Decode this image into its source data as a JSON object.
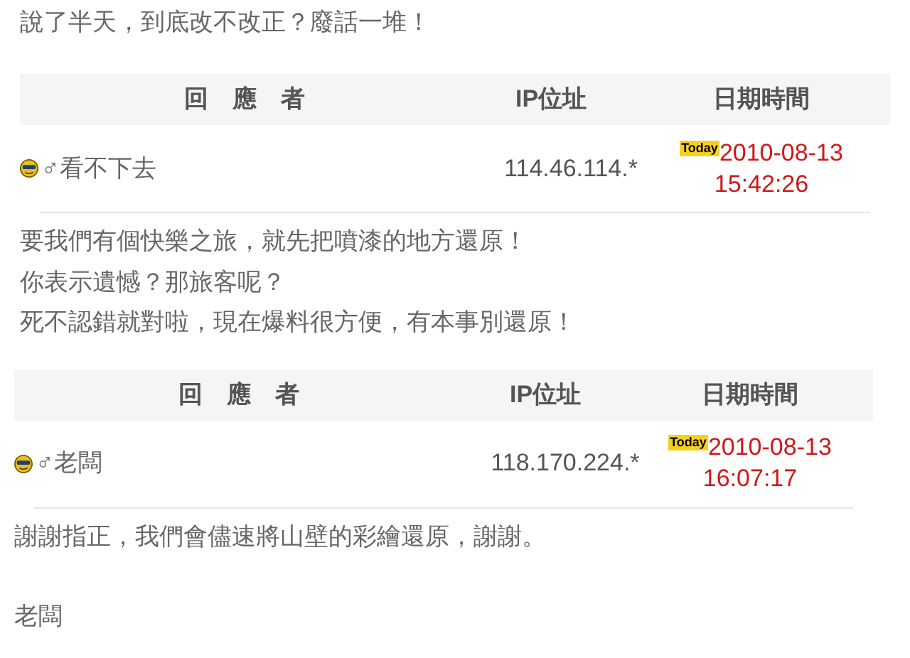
{
  "intro": "說了半天，到底改不改正？廢話一堆！",
  "replies": [
    {
      "columns": [
        "回　應　者",
        "IP位址",
        "日期時間"
      ],
      "author": "♂看不下去",
      "ip": "114.46.114.*",
      "badge": "Today",
      "date": "2010-08-13",
      "time": "15:42:26",
      "lines": [
        "要我們有個快樂之旅，就先把噴漆的地方還原！",
        "你表示遺憾？那旅客呢？",
        "死不認錯就對啦，現在爆料很方便，有本事別還原！"
      ]
    },
    {
      "columns": [
        "回　應　者",
        "IP位址",
        "日期時間"
      ],
      "author": "♂老闆",
      "ip": "118.170.224.*",
      "badge": "Today",
      "date": "2010-08-13",
      "time": "16:07:17",
      "lines": [
        "謝謝指正，我們會儘速將山壁的彩繪還原，謝謝。"
      ],
      "signature": "老闆"
    }
  ]
}
